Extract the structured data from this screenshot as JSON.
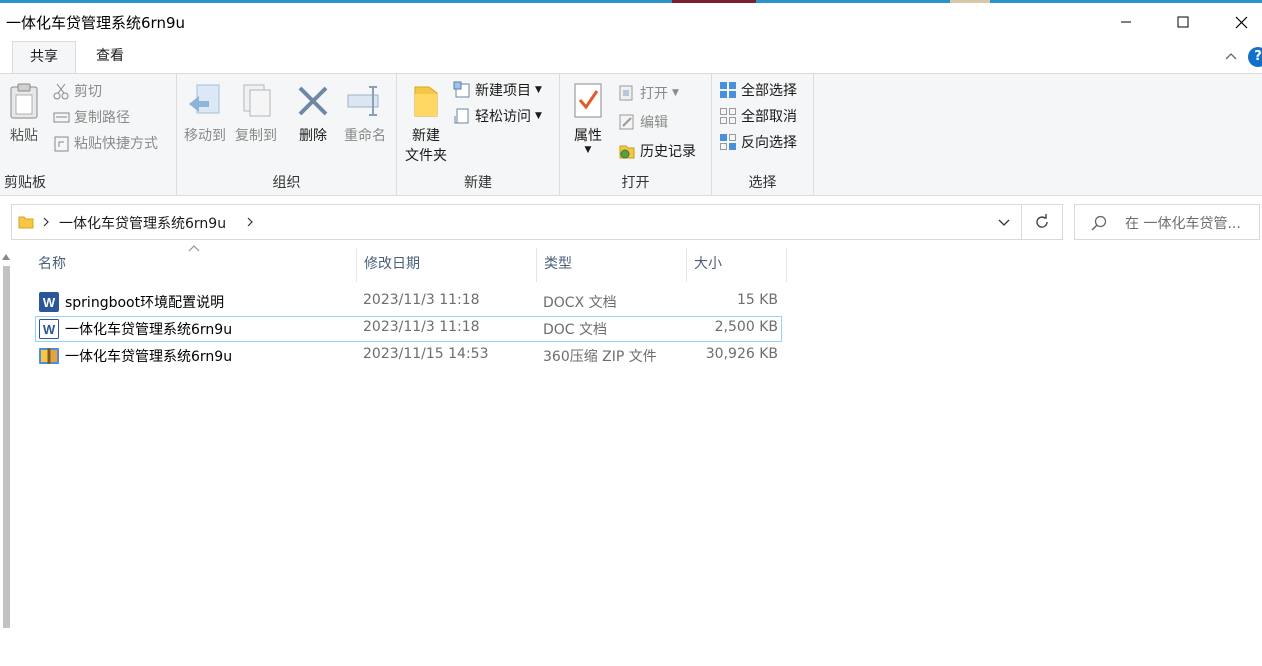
{
  "window": {
    "title": "一体化车贷管理系统6rn9u"
  },
  "tabs": [
    {
      "label": "共享"
    },
    {
      "label": "查看"
    }
  ],
  "ribbon": {
    "clipboard": {
      "paste": "粘贴",
      "cut": "剪切",
      "copy_path": "复制路径",
      "paste_shortcut": "粘贴快捷方式",
      "group": "剪贴板"
    },
    "organize": {
      "move_to": "移动到",
      "copy_to": "复制到",
      "delete": "删除",
      "rename": "重命名",
      "group": "组织"
    },
    "new": {
      "new_folder_line1": "新建",
      "new_folder_line2": "文件夹",
      "new_item": "新建项目",
      "easy_access": "轻松访问",
      "group": "新建"
    },
    "open": {
      "properties": "属性",
      "open": "打开",
      "edit": "编辑",
      "history": "历史记录",
      "group": "打开"
    },
    "select": {
      "select_all": "全部选择",
      "select_none": "全部取消",
      "invert": "反向选择",
      "group": "选择"
    }
  },
  "address": {
    "crumb": "一体化车贷管理系统6rn9u",
    "search_placeholder": "在 一体化车贷管..."
  },
  "columns": {
    "name": "名称",
    "modified": "修改日期",
    "type": "类型",
    "size": "大小"
  },
  "files": [
    {
      "name": "springboot环境配置说明",
      "modified": "2023/11/3 11:18",
      "type": "DOCX 文档",
      "size": "15 KB",
      "icon": "word-docx-icon",
      "selected": false
    },
    {
      "name": "一体化车贷管理系统6rn9u",
      "modified": "2023/11/3 11:18",
      "type": "DOC 文档",
      "size": "2,500 KB",
      "icon": "word-doc-icon",
      "selected": true
    },
    {
      "name": "一体化车贷管理系统6rn9u",
      "modified": "2023/11/15 14:53",
      "type": "360压缩 ZIP 文件",
      "size": "30,926 KB",
      "icon": "zip-archive-icon",
      "selected": false
    }
  ],
  "colors": {
    "accent": "#1170c9",
    "selection_border": "#99d1ff",
    "ribbon_bg": "#f5f6f7"
  }
}
